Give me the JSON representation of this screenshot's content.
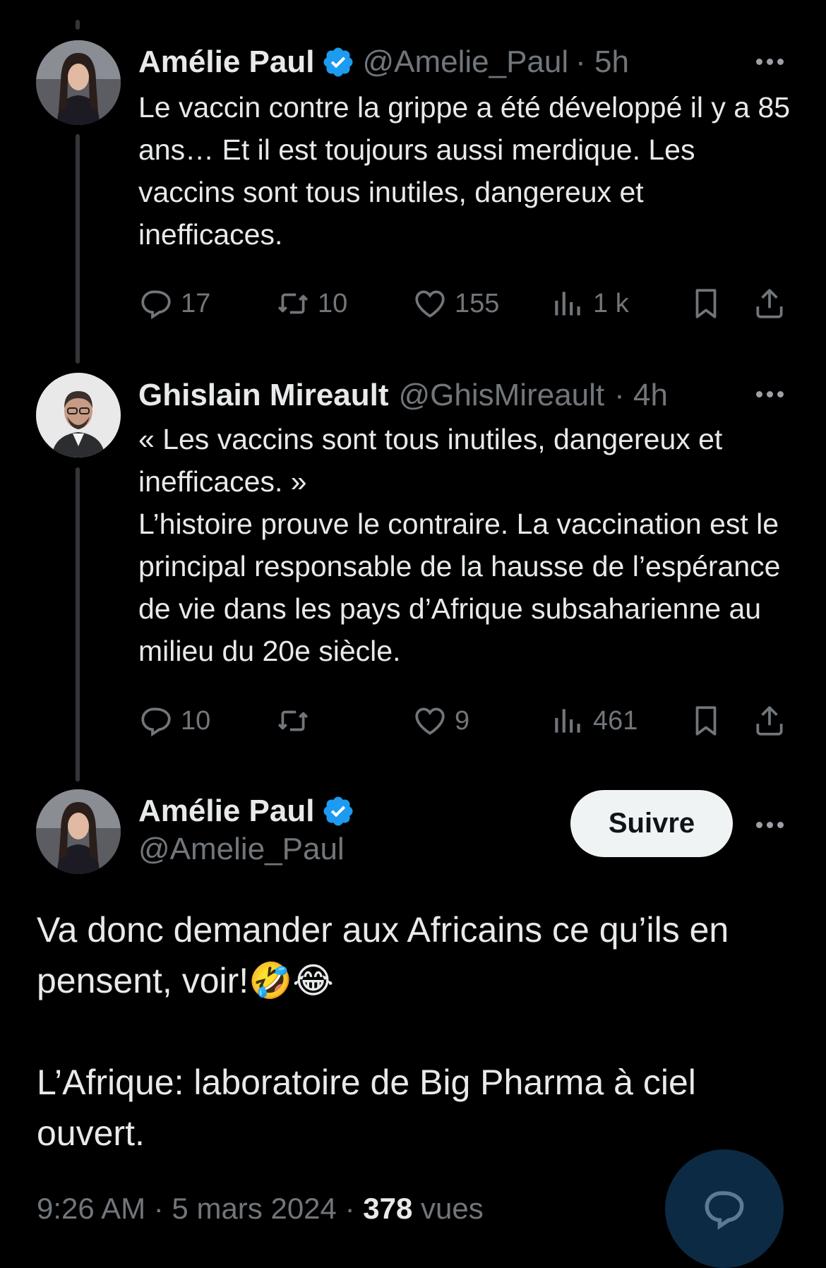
{
  "colors": {
    "background": "#000000",
    "text": "#e7e9ea",
    "muted": "#71767b",
    "verified": "#1d9bf0",
    "follow_bg": "#eff3f4"
  },
  "tweets": [
    {
      "name": "Amélie Paul",
      "handle": "@Amelie_Paul",
      "time": "· 5h",
      "text": "Le vaccin contre la grippe a été développé il y a 85 ans… Et il est toujours aussi merdique. Les vaccins sont tous inutiles, dangereux et inefficaces.",
      "replies": "17",
      "reposts": "10",
      "likes": "155",
      "views": "1 k"
    },
    {
      "name": "Ghislain Mireault",
      "handle": "@GhisMireault",
      "time": "· 4h",
      "text": "« Les vaccins sont tous inutiles, dangereux et inefficaces. »\nL’histoire prouve le contraire. La vaccination est le principal responsable de la hausse de l’espérance de vie dans les pays d’Afrique subsaharienne au milieu du 20e siècle.",
      "replies": "10",
      "reposts": "",
      "likes": "9",
      "views": "461"
    }
  ],
  "main_tweet": {
    "name": "Amélie Paul",
    "handle": "@Amelie_Paul",
    "follow_label": "Suivre",
    "paragraph1": "Va donc demander aux Africains ce qu’ils en pensent, voir!🤣😂",
    "paragraph2": "L’Afrique: laboratoire de Big Pharma à ciel ouvert.",
    "time": "9:26 AM",
    "date": "· 5 mars 2024 ·",
    "views_count": "378",
    "views_label": "vues"
  }
}
